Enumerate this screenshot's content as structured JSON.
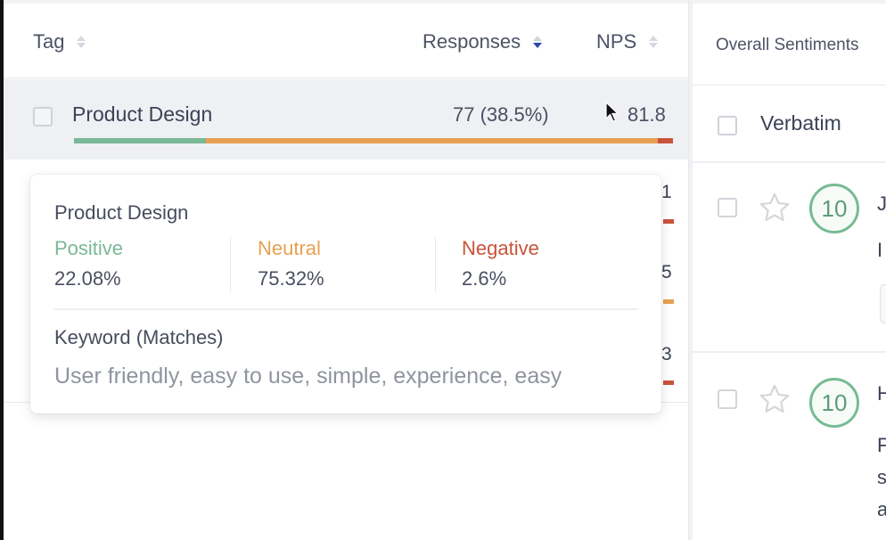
{
  "colors": {
    "positive": "#7ab897",
    "neutral": "#e8a052",
    "negative": "#c9533b",
    "sort_active": "#2d47b5",
    "score_ring": "#77bb93"
  },
  "tags_table": {
    "columns": [
      {
        "label": "Tag",
        "sort": "none"
      },
      {
        "label": "Responses",
        "sort": "descending"
      },
      {
        "label": "NPS",
        "sort": "none"
      }
    ],
    "rows": [
      {
        "name": "Product Design",
        "responses": "77 (38.5%)",
        "nps": "81.8",
        "sentiment_split": {
          "positive": 22.08,
          "neutral": 75.32,
          "negative": 2.6
        }
      }
    ],
    "hidden_rows_partial": [
      {
        "nps_partial": "1",
        "bar_color": "negative"
      },
      {
        "nps_partial": "5",
        "bar_color": "neutral"
      },
      {
        "nps_partial": "3",
        "bar_color": "negative"
      }
    ]
  },
  "tooltip": {
    "title": "Product Design",
    "positive_label": "Positive",
    "positive_value": "22.08%",
    "neutral_label": "Neutral",
    "neutral_value": "75.32%",
    "negative_label": "Negative",
    "negative_value": "2.6%",
    "keyword_title": "Keyword (Matches)",
    "keywords": "User friendly, easy to use, simple, experience, easy"
  },
  "verbatim_panel": {
    "header": "Overall Sentiments",
    "subheader": "Verbatim",
    "items": [
      {
        "score": "10",
        "peek_line1": "J",
        "peek_line2": "I"
      },
      {
        "score": "10",
        "peek_line1": "H",
        "peek_line2": "F",
        "peek_line3": "s",
        "peek_line4": "a"
      }
    ]
  },
  "icons": {
    "sort": "sort-icon",
    "checkbox": "checkbox-icon",
    "star": "star-icon",
    "cursor": "cursor-icon"
  }
}
